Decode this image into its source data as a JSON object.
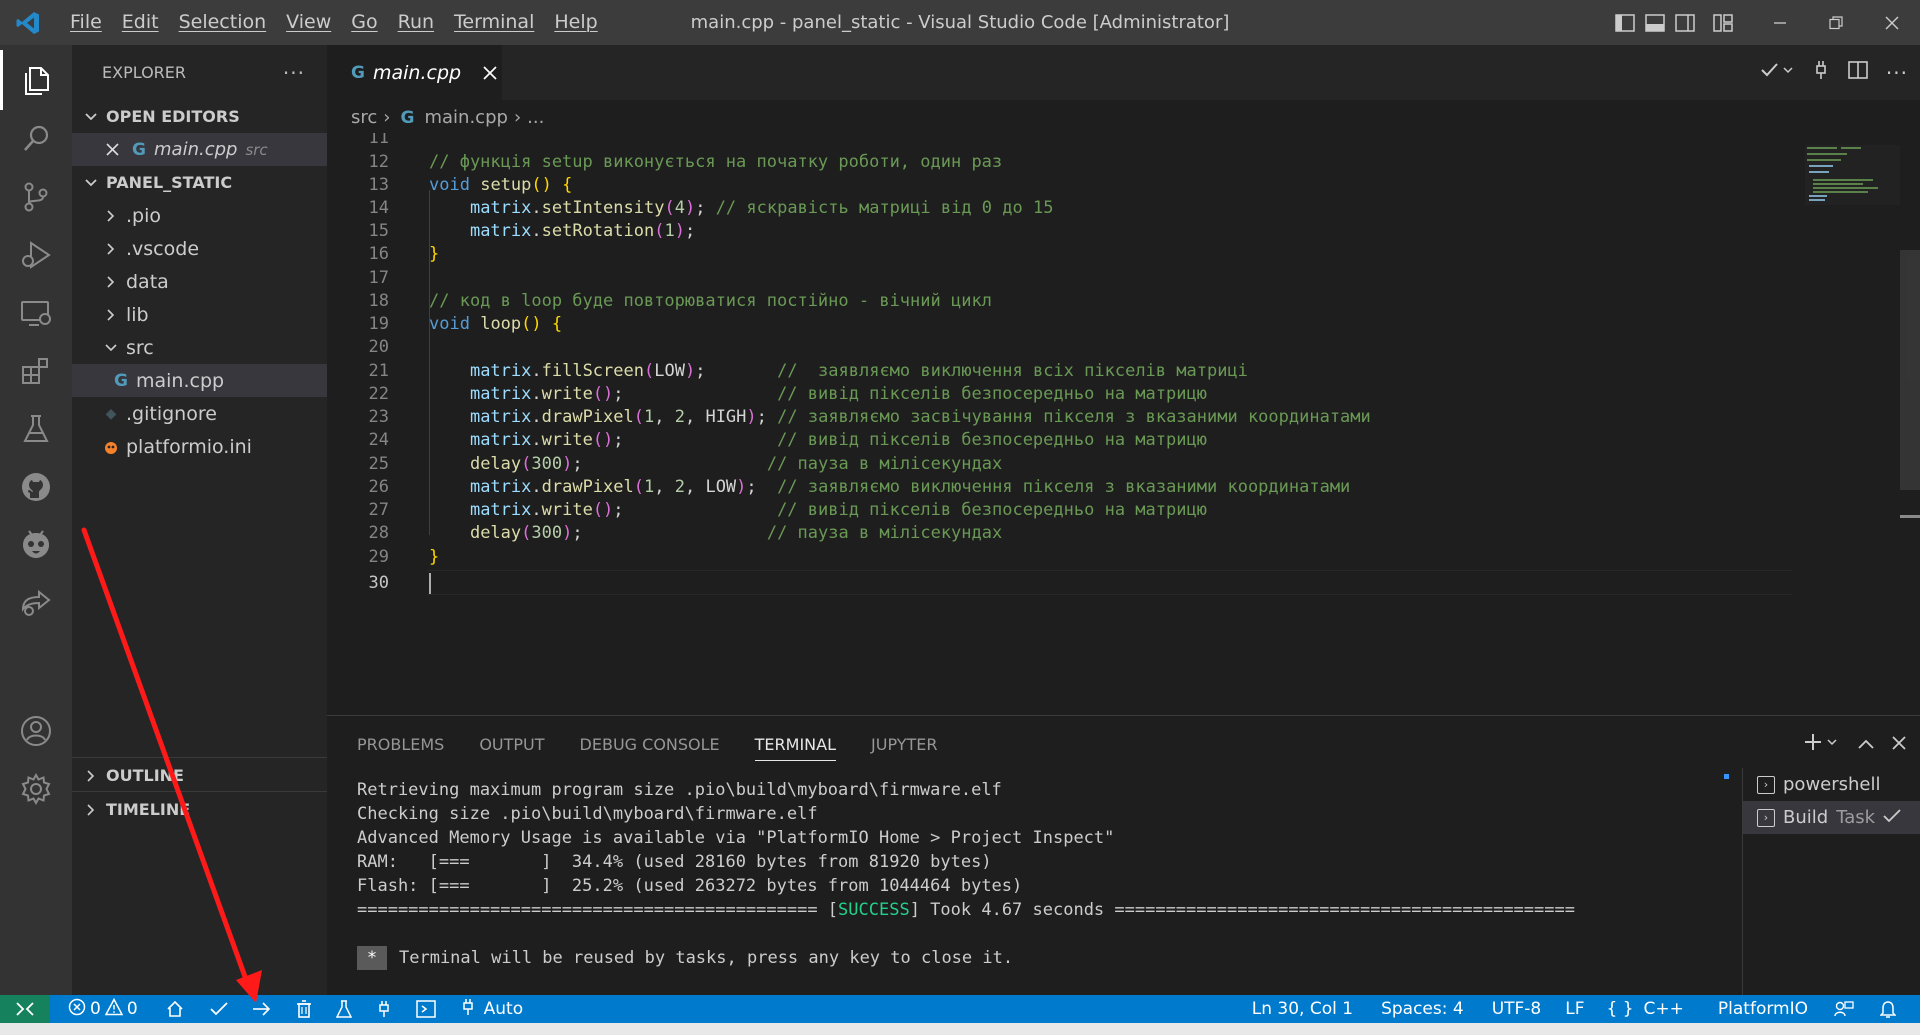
{
  "titlebar": {
    "menu": [
      "File",
      "Edit",
      "Selection",
      "View",
      "Go",
      "Run",
      "Terminal",
      "Help"
    ],
    "window_title": "main.cpp - panel_static - Visual Studio Code [Administrator]"
  },
  "sidebar": {
    "title": "EXPLORER",
    "more": "···",
    "open_editors_label": "OPEN EDITORS",
    "open_editor_file": "main.cpp",
    "open_editor_dir": "src",
    "project_label": "PANEL_STATIC",
    "tree": [
      ".pio",
      ".vscode",
      "data",
      "lib",
      "src",
      "main.cpp",
      ".gitignore",
      "platformio.ini"
    ],
    "outline_label": "OUTLINE",
    "timeline_label": "TIMELINE"
  },
  "editor": {
    "tab_label": "main.cpp",
    "breadcrumb": [
      "src",
      "main.cpp",
      "..."
    ],
    "line_numbers": [
      "11",
      "12",
      "13",
      "14",
      "15",
      "16",
      "17",
      "18",
      "19",
      "20",
      "21",
      "22",
      "23",
      "24",
      "25",
      "26",
      "27",
      "28",
      "29",
      "30"
    ],
    "comment_12": "// функція setup виконується на початку роботи, один раз",
    "comment_14": "// яскравість матриці від 0 до 15",
    "comment_18": "// код в loop буде повторюватися постійно - вічний цикл",
    "comment_21": "//  заявляємо виключення всіх пікселів матриці",
    "comment_22": "// вивід пікселів безпосередньо на матрицю",
    "comment_23": "// заявляємо засвічування пікселя з вказаними координатами",
    "comment_24": "// вивід пікселів безпосередньо на матрицю",
    "comment_25": "// пауза в мілісекундах",
    "comment_26": "// заявляємо виключення пікселя з вказаними координатами",
    "comment_27": "// вивід пікселів безпосередньо на матрицю",
    "comment_28": "// пауза в мілісекундах"
  },
  "panel": {
    "tabs": [
      "PROBLEMS",
      "OUTPUT",
      "DEBUG CONSOLE",
      "TERMINAL",
      "JUPYTER"
    ],
    "terminal_lines": [
      "Retrieving maximum program size .pio\\build\\myboard\\firmware.elf",
      "Checking size .pio\\build\\myboard\\firmware.elf",
      "Advanced Memory Usage is available via \"PlatformIO Home > Project Inspect\"",
      "RAM:   [===       ]  34.4% (used 28160 bytes from 81920 bytes)",
      "Flash: [===       ]  25.2% (used 263272 bytes from 1044464 bytes)"
    ],
    "success_prefix": "============================================= [",
    "success_word": "SUCCESS",
    "success_suffix": "] Took 4.67 seconds =============================================",
    "reuse_star": "*",
    "reuse_msg": "Terminal will be reused by tasks, press any key to close it.",
    "terminals": [
      {
        "name": "powershell"
      },
      {
        "name": "Build",
        "suffix": "Task"
      }
    ]
  },
  "statusbar": {
    "errors": "0",
    "warnings": "0",
    "env": "Auto",
    "position": "Ln 30, Col 1",
    "spaces": "Spaces: 4",
    "encoding": "UTF-8",
    "eol": "LF",
    "language": "C++",
    "platform": "PlatformIO"
  },
  "colors": {
    "statusbar": "#007acc",
    "remote": "#16825d",
    "annotation_arrow": "#ff1a1a"
  }
}
